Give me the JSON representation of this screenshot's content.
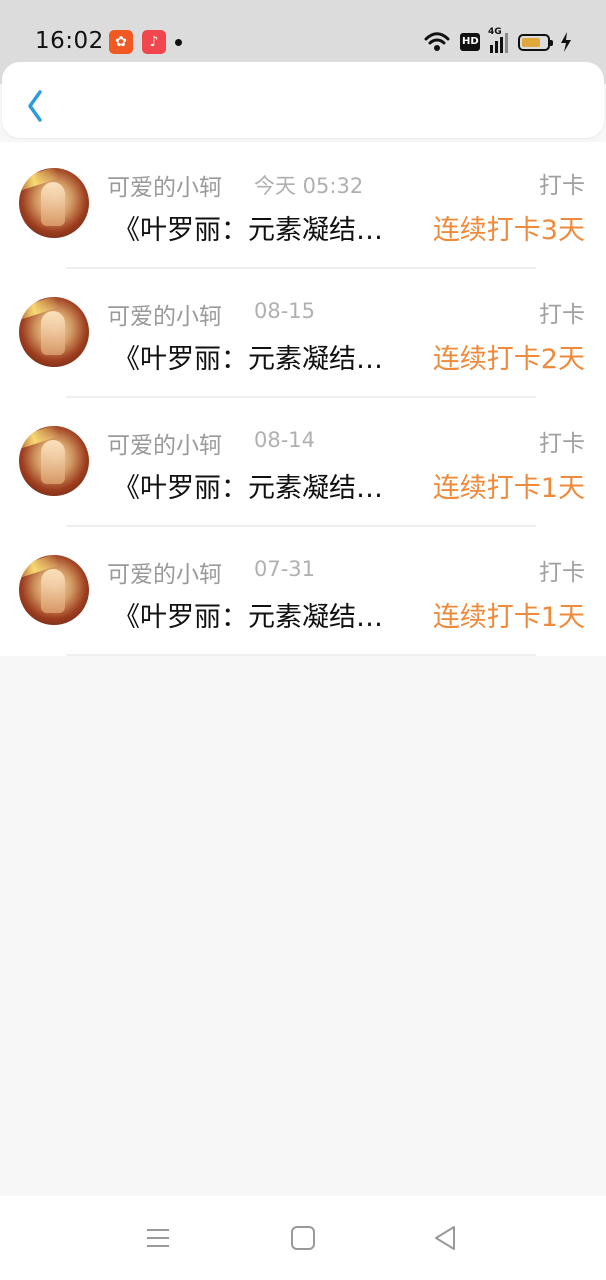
{
  "status_bar": {
    "time": "16:02",
    "app_icons": [
      "kuaishou-icon",
      "music-icon"
    ],
    "hd_label": "HD",
    "network_label": "4G",
    "battery_level": 0.75
  },
  "header": {
    "back_icon": "chevron-left-icon"
  },
  "items": [
    {
      "name": "可爱的小轲",
      "time": "今天 05:32",
      "label": "打卡",
      "title": "《叶罗丽：元素凝结…",
      "streak": "连续打卡3天"
    },
    {
      "name": "可爱的小轲",
      "time": "08-15",
      "label": "打卡",
      "title": "《叶罗丽：元素凝结…",
      "streak": "连续打卡2天"
    },
    {
      "name": "可爱的小轲",
      "time": "08-14",
      "label": "打卡",
      "title": "《叶罗丽：元素凝结…",
      "streak": "连续打卡1天"
    },
    {
      "name": "可爱的小轲",
      "time": "07-31",
      "label": "打卡",
      "title": "《叶罗丽：元素凝结…",
      "streak": "连续打卡1天"
    }
  ],
  "colors": {
    "accent": "#f08a3b",
    "back_icon": "#2d9cdb",
    "secondary_text": "#9a9a9a"
  },
  "navbar": {
    "buttons": [
      "menu-icon",
      "home-icon",
      "back-icon"
    ]
  }
}
